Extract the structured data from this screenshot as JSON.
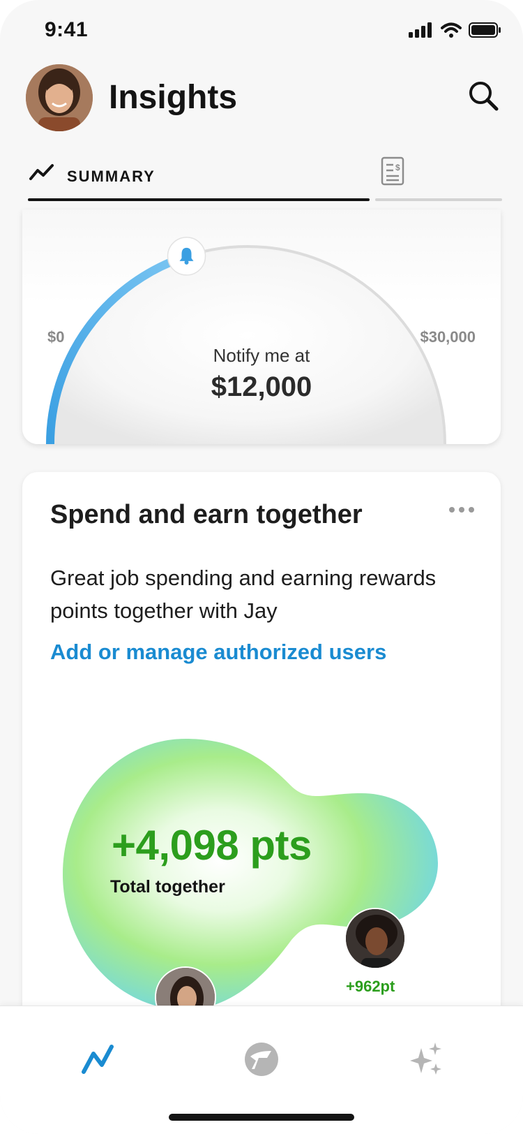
{
  "status_bar": {
    "time": "9:41"
  },
  "header": {
    "title": "Insights"
  },
  "tabs": {
    "summary_label": "SUMMARY"
  },
  "gauge": {
    "min_label": "$0",
    "max_label": "$30,000",
    "notify_label": "Notify me at",
    "notify_value": "$12,000",
    "level_fraction": 0.4,
    "accent_color": "#5ab3ea"
  },
  "spend_card": {
    "title": "Spend and earn together",
    "body": "Great job spending and earning rewards points together with Jay",
    "link": "Add or manage authorized users",
    "total_points": "+4,098 pts",
    "total_label": "Total together",
    "member_points": "+962pt"
  },
  "colors": {
    "link": "#1a8bd1",
    "points_green": "#2c9e1d",
    "active_nav": "#1a8bd1"
  },
  "icons": [
    "avatar",
    "search-icon",
    "trend-icon",
    "statement-icon",
    "bell-icon",
    "more-icon",
    "insights-nav-icon",
    "rewards-nav-icon",
    "sparkle-nav-icon"
  ]
}
